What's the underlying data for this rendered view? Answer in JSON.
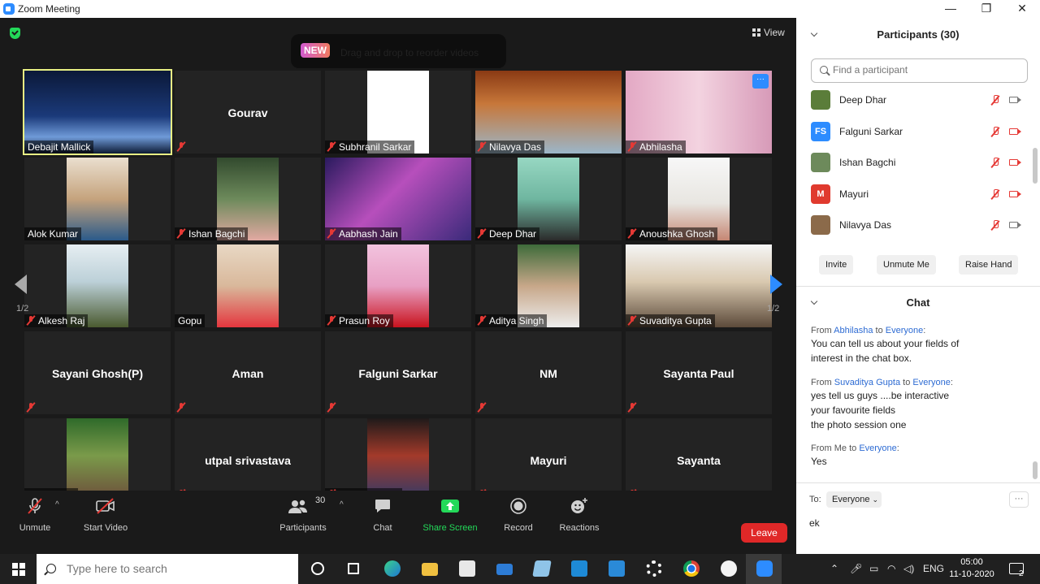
{
  "window": {
    "title": "Zoom Meeting",
    "minimize": "—",
    "maximize": "❐",
    "close": "✕"
  },
  "view_label": "View",
  "banner": {
    "badge": "NEW",
    "text": "Drag and drop to reorder videos"
  },
  "pages": {
    "left": "1/2",
    "right": "1/2"
  },
  "tiles": [
    {
      "name": "Debajit Mallick",
      "video": true,
      "muted": false,
      "active": true,
      "bg": "linear-gradient(180deg,#0b1838 0%,#1b3a7a 55%,#6f9ad8 80%,#0d1a33 100%)"
    },
    {
      "name": "Gourav",
      "video": false,
      "muted": true
    },
    {
      "name": "Subhranil Sarkar",
      "video": true,
      "muted": true,
      "bg": "#ffffff",
      "narrow": true
    },
    {
      "name": "Nilavya Das",
      "video": true,
      "muted": true,
      "bg": "linear-gradient(180deg,#8a3a14,#c7773a 40%,#9bb6c9)"
    },
    {
      "name": "Abhilasha",
      "video": true,
      "muted": true,
      "bg": "linear-gradient(90deg,#e3a8c4,#f3d3e0 50%,#d79ab8)",
      "more": true
    },
    {
      "name": "Alok Kumar",
      "video": true,
      "muted": false,
      "bg": "linear-gradient(180deg,#eadfcf,#c5a37d 50%,#2a5a8a)",
      "narrow": true
    },
    {
      "name": "Ishan Bagchi",
      "video": true,
      "muted": true,
      "bg": "linear-gradient(180deg,#324a2e,#6d8a5b 50%,#e2a9a2)",
      "narrow": true
    },
    {
      "name": "Aabhash Jain",
      "video": true,
      "muted": true,
      "bg": "linear-gradient(135deg,#2a1a5e,#b74fbc 45%,#3a2a7a)"
    },
    {
      "name": "Deep Dhar",
      "video": true,
      "muted": true,
      "bg": "linear-gradient(180deg,#97d7c2,#6fb6a0 50%,#2b2b2b)",
      "narrow": true
    },
    {
      "name": "Anoushka Ghosh",
      "video": true,
      "muted": true,
      "bg": "linear-gradient(180deg,#f7f7f7,#e8e6e1 55%,#c58673)",
      "narrow": true
    },
    {
      "name": "Alkesh Raj",
      "video": true,
      "muted": true,
      "bg": "linear-gradient(180deg,#e6eef2,#bcd0d8 45%,#4a5a2f)",
      "narrow": true
    },
    {
      "name": "Gopu",
      "video": true,
      "muted": false,
      "bg": "linear-gradient(180deg,#e8d8c4,#d9b89b 50%,#e4363e)",
      "narrow": true
    },
    {
      "name": "Prasun Roy",
      "video": true,
      "muted": true,
      "bg": "linear-gradient(180deg,#f2c3de,#e8a0c4 50%,#c9131e)",
      "narrow": true
    },
    {
      "name": "Aditya Singh",
      "video": true,
      "muted": true,
      "bg": "linear-gradient(180deg,#3e6b3a,#c7a789 50%,#ededed)",
      "narrow": true
    },
    {
      "name": "Suvaditya Gupta",
      "video": true,
      "muted": true,
      "bg": "linear-gradient(180deg,#f5f5f5,#d9c9b0 45%,#5c4a3a)"
    },
    {
      "name": "Sayani Ghosh(P)",
      "video": false,
      "muted": true
    },
    {
      "name": "Aman",
      "video": false,
      "muted": true
    },
    {
      "name": "Falguni Sarkar",
      "video": false,
      "muted": true
    },
    {
      "name": "NM",
      "video": false,
      "muted": true
    },
    {
      "name": "Sayanta Paul",
      "video": false,
      "muted": true
    },
    {
      "name": "Deep Dhar",
      "video": true,
      "muted": false,
      "bg": "linear-gradient(180deg,#2f6a2a,#7a9a4a 45%,#6c4b3a)",
      "narrow": true
    },
    {
      "name": "utpal srivastava",
      "video": false,
      "muted": true
    },
    {
      "name": "Shweta Rashi",
      "video": true,
      "muted": true,
      "bg": "linear-gradient(180deg,#1f1a1a,#a33a2a 45%,#2e3a6a)",
      "narrow": true
    },
    {
      "name": "Mayuri",
      "video": false,
      "muted": true
    },
    {
      "name": "Sayanta",
      "video": false,
      "muted": true
    }
  ],
  "toolbar": {
    "unmute": "Unmute",
    "start_video": "Start Video",
    "participants": "Participants",
    "participants_count": "30",
    "chat": "Chat",
    "share_screen": "Share Screen",
    "record": "Record",
    "reactions": "Reactions",
    "leave": "Leave"
  },
  "panel": {
    "participants_title": "Participants (30)",
    "search_placeholder": "Find a participant",
    "participants": [
      {
        "name": "Deep Dhar",
        "initials": "",
        "color": "#5b7d3a",
        "video_off": false
      },
      {
        "name": "Falguni Sarkar",
        "initials": "FS",
        "color": "#2d8cff",
        "video_off": true
      },
      {
        "name": "Ishan Bagchi",
        "initials": "",
        "color": "#6d8a5b",
        "video_off": true
      },
      {
        "name": "Mayuri",
        "initials": "M",
        "color": "#e03a2e",
        "video_off": true
      },
      {
        "name": "Nilavya Das",
        "initials": "",
        "color": "#8b6a4a",
        "video_off": false
      }
    ],
    "buttons": {
      "invite": "Invite",
      "unmute_me": "Unmute Me",
      "raise_hand": "Raise Hand"
    },
    "chat_title": "Chat",
    "messages": [
      {
        "from_prefix": "From",
        "sender": "Abhilasha",
        "to_word": "to",
        "recipient": "Everyone",
        "lines": [
          "You can tell us about your fields of",
          "interest in the chat box."
        ]
      },
      {
        "from_prefix": "From",
        "sender": "Suvaditya Gupta",
        "to_word": "to",
        "recipient": "Everyone",
        "lines": [
          "yes tell us guys ....be interactive",
          "your favourite fields",
          "the photo session one"
        ]
      },
      {
        "from_prefix": "From Me",
        "sender": "",
        "to_word": "to",
        "recipient": "Everyone",
        "lines": [
          "Yes"
        ]
      }
    ],
    "to_label": "To:",
    "to_value": "Everyone",
    "more_btn": "···",
    "input_value": "ek"
  },
  "taskbar": {
    "search_placeholder": "Type here to search",
    "lang": "ENG",
    "time": "05:00",
    "date": "11-10-2020",
    "notifications": "2"
  },
  "colors": {
    "accent": "#2d8cff",
    "share_green": "#23d959",
    "leave_red": "#e02828",
    "muted_red": "#e53935",
    "active_outline": "#e8f084"
  }
}
